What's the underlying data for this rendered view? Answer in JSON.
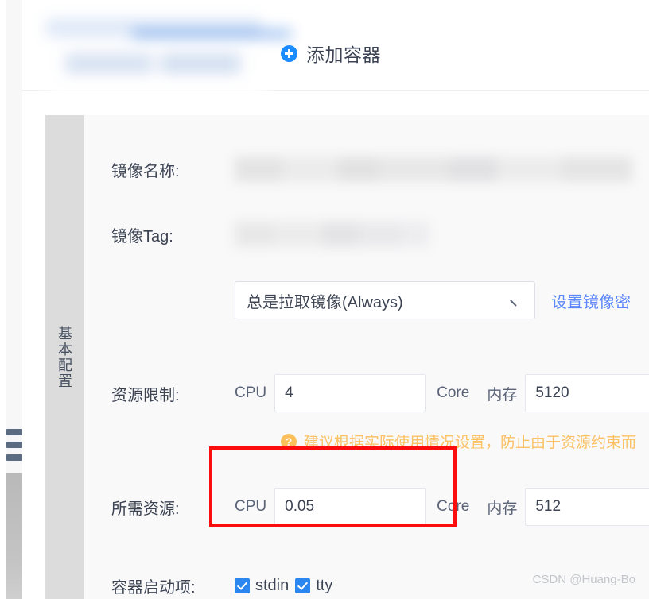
{
  "header": {
    "add_container_label": "添加容器",
    "add_container_icon": "plus-circle-icon",
    "redacted_tab_note": "blurred"
  },
  "sidebar": {
    "vertical_tab_label": "基本配置",
    "collapse_handle_icon": "drag-handle-icon"
  },
  "form": {
    "rows": {
      "image_name": {
        "label": "镜像名称:",
        "value": ""
      },
      "image_tag": {
        "label": "镜像Tag:",
        "value": ""
      },
      "pull_policy": {
        "selected": "总是拉取镜像(Always)",
        "chevron_icon": "chevron-down-icon",
        "link_label": "设置镜像密"
      },
      "resource_limit": {
        "label": "资源限制:",
        "cpu_unit_prefix": "CPU",
        "cpu_value": "4",
        "core_label": "Core",
        "memory_label": "内存",
        "memory_value": "5120"
      },
      "hint": {
        "icon": "question-circle-icon",
        "text": "建议根据实际使用情况设置，防止由于资源约束而"
      },
      "required_resource": {
        "label": "所需资源:",
        "cpu_unit_prefix": "CPU",
        "cpu_value": "0.05",
        "core_label": "Core",
        "memory_label": "内存",
        "memory_value": "512"
      },
      "startup_options": {
        "label": "容器启动项:",
        "options": [
          {
            "label": "stdin",
            "checked": true
          },
          {
            "label": "tty",
            "checked": true
          }
        ]
      }
    }
  },
  "annotation": {
    "shape": "rectangle",
    "color": "#fc0d0d",
    "targets": "required-resource-cpu-field"
  },
  "watermark": {
    "text": "CSDN @Huang-Bo"
  },
  "colors": {
    "accent_blue": "#1a8cff",
    "link_blue": "#5b87fa",
    "checkbox_blue": "#2b86f0",
    "hint_orange": "#fbc164",
    "annotation_red": "#fc0d0d",
    "panel_bg": "#f9f9f9",
    "tab_bg": "#dcdcdc"
  }
}
